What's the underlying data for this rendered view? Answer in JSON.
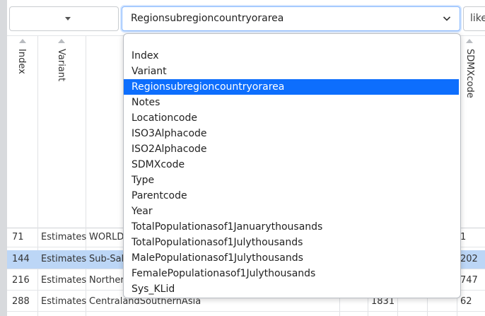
{
  "filter": {
    "column_value": "Regionsubregioncountryorarea",
    "operator_value": "like"
  },
  "columns": [
    "Index",
    "Variant",
    "SDMXcode"
  ],
  "column_options": [
    "Index",
    "Variant",
    "Regionsubregioncountryorarea",
    "Notes",
    "Locationcode",
    "ISO3Alphacode",
    "ISO2Alphacode",
    "SDMXcode",
    "Type",
    "Parentcode",
    "Year",
    "TotalPopulationasof1Januarythousands",
    "TotalPopulationasof1Julythousands",
    "MalePopulationasof1Julythousands",
    "FemalePopulationasof1Julythousands",
    "Sys_KLid"
  ],
  "selected_option": "Regionsubregioncountryorarea",
  "rows": [
    {
      "index": "71",
      "variant": "Estimates",
      "region": "WORLD",
      "code": "",
      "sdmx": "1"
    },
    {
      "index": "144",
      "variant": "Estimates",
      "region": "Sub-Sah",
      "code": "",
      "sdmx": "202"
    },
    {
      "index": "216",
      "variant": "Estimates",
      "region": "Norther",
      "code": "",
      "sdmx": "747"
    },
    {
      "index": "288",
      "variant": "Estimates",
      "region": "CentralandSouthernAsia",
      "code": "1831",
      "sdmx": "62"
    }
  ],
  "colors": {
    "accent": "#0d6efd",
    "selected_row": "#bcd6f6"
  }
}
